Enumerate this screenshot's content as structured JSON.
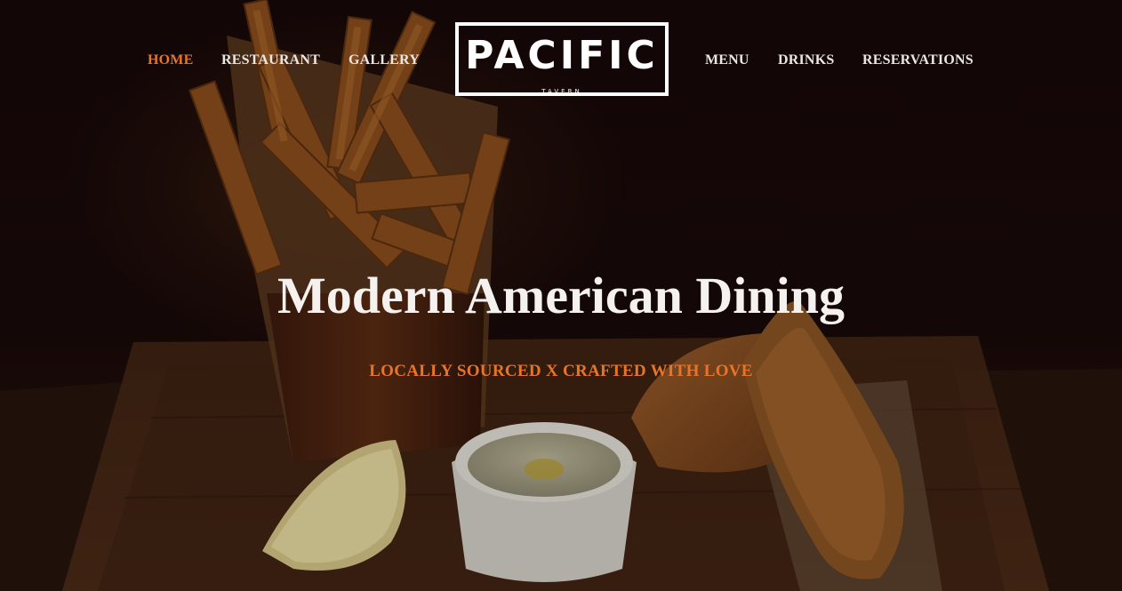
{
  "nav": {
    "left": [
      {
        "label": "HOME",
        "active": true
      },
      {
        "label": "RESTAURANT",
        "active": false
      },
      {
        "label": "GALLERY",
        "active": false
      }
    ],
    "right": [
      {
        "label": "MENU",
        "active": false
      },
      {
        "label": "DRINKS",
        "active": false
      },
      {
        "label": "RESERVATIONS",
        "active": false
      }
    ]
  },
  "logo": {
    "main": "PACIFIC",
    "sub": "TAVERN"
  },
  "hero": {
    "headline": "Modern American Dining",
    "tagline": "LOCALLY SOURCED X CRAFTED WITH LOVE",
    "background_icon": "fish-and-chips-photo"
  },
  "colors": {
    "accent": "#e8742a",
    "background": "#150707",
    "text": "#f4f1ee"
  }
}
